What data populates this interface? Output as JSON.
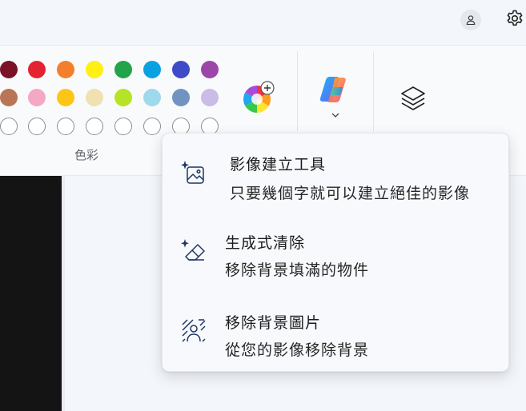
{
  "titlebar": {
    "icons": {
      "account": "person-icon",
      "settings": "gear-icon"
    }
  },
  "ribbon": {
    "colors_label": "色彩",
    "palette_rows": [
      [
        "#7a1126",
        "#e52330",
        "#f37f2c",
        "#ffef15",
        "#23a34a",
        "#0aa1e3",
        "#3e4bc9",
        "#9c46a9"
      ],
      [
        "#b97555",
        "#f5a8c2",
        "#fdc516",
        "#efe1b0",
        "#b5e325",
        "#9fd9ec",
        "#7193c2",
        "#c9bce6"
      ],
      [
        "",
        "",
        "",
        "",
        "",
        "",
        "",
        ""
      ]
    ],
    "icons": {
      "edit_colors": "color-wheel-plus-icon",
      "copilot": "copilot-icon",
      "copilot_expand": "chevron-down-icon",
      "layers": "layers-icon"
    }
  },
  "menu": {
    "items": [
      {
        "title": "影像建立工具",
        "desc": "只要幾個字就可以建立絕佳的影像",
        "icon": "image-sparkle-icon"
      },
      {
        "title": "生成式清除",
        "desc": "移除背景填滿的物件",
        "icon": "eraser-sparkle-icon"
      },
      {
        "title": "移除背景圖片",
        "desc": "從您的影像移除背景",
        "icon": "remove-background-icon"
      }
    ]
  }
}
